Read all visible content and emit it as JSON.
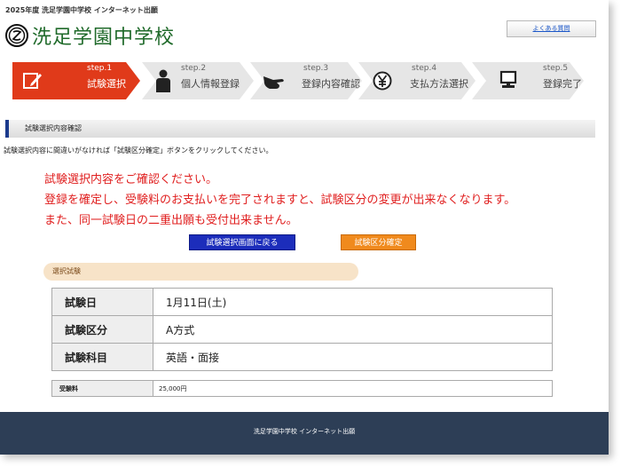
{
  "header": {
    "top_title": "2025年度 洗足学園中学校 インターネット出願",
    "school_name": "洗足学園中学校",
    "faq_label": "よくある質問"
  },
  "steps": [
    {
      "num": "step.1",
      "label": "試験選択",
      "icon": "pencil-icon",
      "active": true
    },
    {
      "num": "step.2",
      "label": "個人情報登録",
      "icon": "person-icon",
      "active": false
    },
    {
      "num": "step.3",
      "label": "登録内容確認",
      "icon": "hand-pointer-icon",
      "active": false
    },
    {
      "num": "step.4",
      "label": "支払方法選択",
      "icon": "yen-icon",
      "active": false
    },
    {
      "num": "step.5",
      "label": "登録完了",
      "icon": "monitor-icon",
      "active": false
    }
  ],
  "section": {
    "title": "試験選択内容確認",
    "instruction": "試験選択内容に間違いがなければ「試験区分確定」ボタンをクリックしてください。"
  },
  "warning_lines": [
    "試験選択内容をご確認ください。",
    "登録を確定し、受験料のお支払いを完了されますと、試験区分の変更が出来なくなります。",
    "また、同一試験日の二重出願も受付出来ません。"
  ],
  "buttons": {
    "back_label": "試験選択画面に戻る",
    "confirm_label": "試験区分確定"
  },
  "selected_exam": {
    "heading": "選択試験",
    "rows": [
      {
        "label": "試験日",
        "value": "1月11日(土)"
      },
      {
        "label": "試験区分",
        "value": "A方式"
      },
      {
        "label": "試験科目",
        "value": "英語・面接"
      }
    ]
  },
  "fee": {
    "label": "受験料",
    "value": "25,000円"
  },
  "footer": {
    "text": "洗足学園中学校 インターネット出願"
  },
  "colors": {
    "active_step": "#e03a1a",
    "inactive_step": "#e6e6e6",
    "warning_text": "#e01f1f",
    "back_button": "#1c2dbb",
    "confirm_button": "#f08a1d",
    "footer": "#2d3e56",
    "logo": "#1f6a2a"
  }
}
